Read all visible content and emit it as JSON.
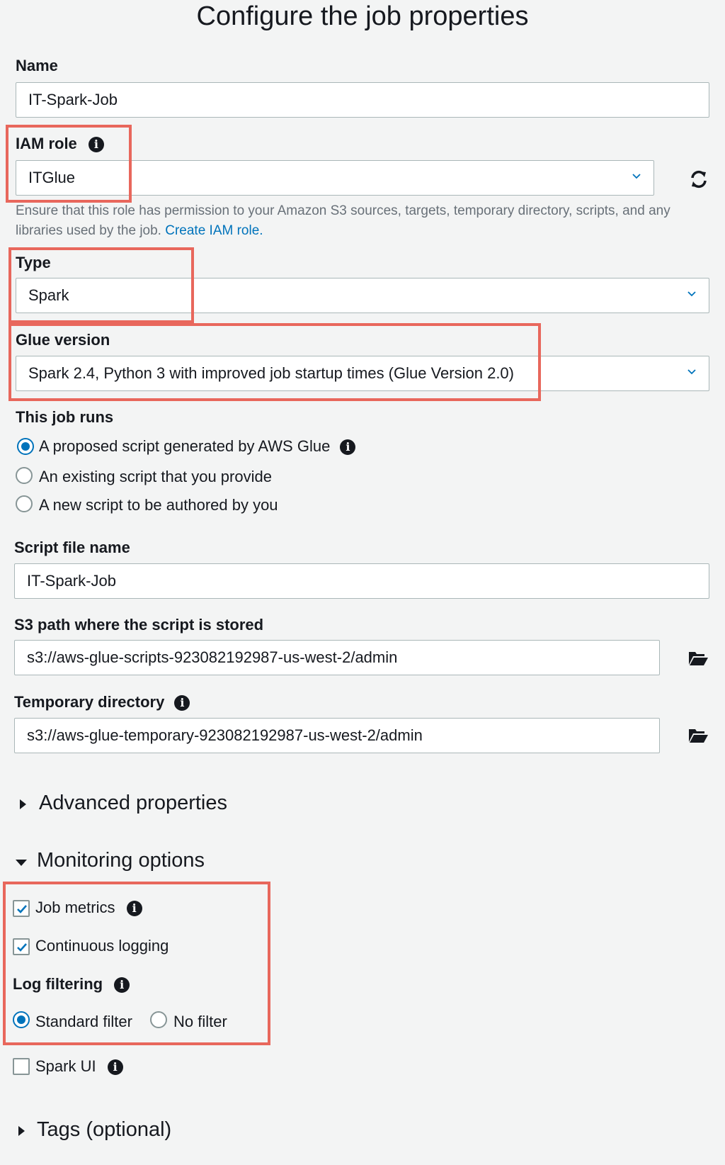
{
  "page": {
    "title": "Configure the job properties"
  },
  "name": {
    "label": "Name",
    "value": "IT-Spark-Job"
  },
  "iam": {
    "label": "IAM role",
    "value": "ITGlue",
    "help": "Ensure that this role has permission to your Amazon S3 sources, targets, temporary directory, scripts, and any libraries used by the job.",
    "link": "Create IAM role."
  },
  "type": {
    "label": "Type",
    "value": "Spark"
  },
  "glue": {
    "label": "Glue version",
    "value": "Spark 2.4, Python 3 with improved job startup times (Glue Version 2.0)"
  },
  "job_runs": {
    "label": "This job runs",
    "options": [
      {
        "label": "A proposed script generated by AWS Glue",
        "selected": true
      },
      {
        "label": "An existing script that you provide",
        "selected": false
      },
      {
        "label": "A new script to be authored by you",
        "selected": false
      }
    ]
  },
  "script_name": {
    "label": "Script file name",
    "value": "IT-Spark-Job"
  },
  "s3_path": {
    "label": "S3 path where the script is stored",
    "value": "s3://aws-glue-scripts-923082192987-us-west-2/admin"
  },
  "temp_dir": {
    "label": "Temporary directory",
    "value": "s3://aws-glue-temporary-923082192987-us-west-2/admin"
  },
  "advanced": {
    "label": "Advanced properties",
    "expanded": false
  },
  "monitoring": {
    "label": "Monitoring options",
    "expanded": true,
    "job_metrics": {
      "label": "Job metrics",
      "checked": true
    },
    "continuous_logging": {
      "label": "Continuous logging",
      "checked": true
    },
    "log_filtering": {
      "label": "Log filtering",
      "options": [
        {
          "label": "Standard filter",
          "selected": true
        },
        {
          "label": "No filter",
          "selected": false
        }
      ]
    },
    "spark_ui": {
      "label": "Spark UI",
      "checked": false
    }
  },
  "tags": {
    "label": "Tags (optional)",
    "expanded": false
  },
  "colors": {
    "accent": "#0073bb",
    "highlight": "#e8675c",
    "background": "#f3f4f4"
  },
  "icons": {
    "info": "info-icon",
    "refresh": "refresh-icon",
    "folder": "folder-open-icon",
    "chevron": "chevron-down-icon"
  }
}
